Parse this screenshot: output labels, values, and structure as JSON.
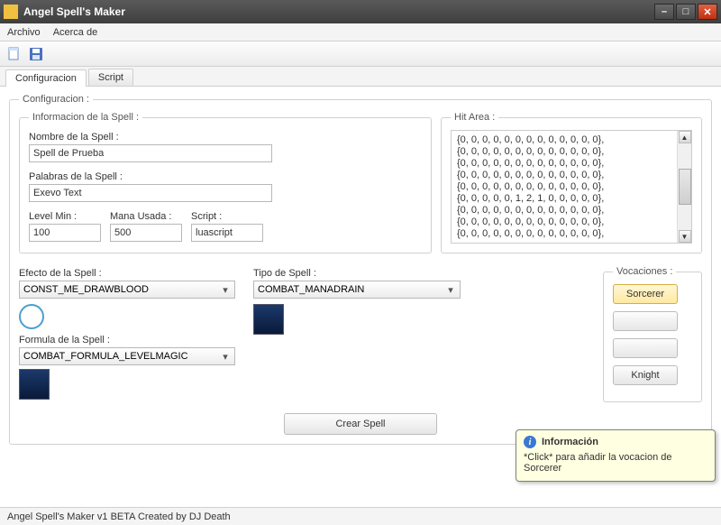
{
  "titlebar": {
    "title": "Angel Spell's Maker"
  },
  "menu": {
    "file": "Archivo",
    "about": "Acerca de"
  },
  "tabs": {
    "config": "Configuracion",
    "script": "Script"
  },
  "groups": {
    "config": "Configuracion :",
    "info": "Informacion de la Spell :",
    "hitarea": "Hit Area :",
    "vocaciones": "Vocaciones :"
  },
  "labels": {
    "name": "Nombre de la Spell :",
    "words": "Palabras de la Spell :",
    "level": "Level Min :",
    "mana": "Mana Usada :",
    "script": "Script :",
    "effect": "Efecto de la Spell :",
    "type": "Tipo de Spell :",
    "formula": "Formula de la Spell :"
  },
  "values": {
    "name": "Spell de Prueba",
    "words": "Exevo Text",
    "level": "100",
    "mana": "500",
    "script": "luascript",
    "effect": "CONST_ME_DRAWBLOOD",
    "type": "COMBAT_MANADRAIN",
    "formula": "COMBAT_FORMULA_LEVELMAGIC"
  },
  "hitarea_lines": [
    "{0, 0, 0, 0, 0, 0, 0, 0, 0, 0, 0, 0, 0},",
    "{0, 0, 0, 0, 0, 0, 0, 0, 0, 0, 0, 0, 0},",
    "{0, 0, 0, 0, 0, 0, 0, 0, 0, 0, 0, 0, 0},",
    "{0, 0, 0, 0, 0, 0, 0, 0, 0, 0, 0, 0, 0},",
    "{0, 0, 0, 0, 0, 0, 0, 0, 0, 0, 0, 0, 0},",
    "{0, 0, 0, 0, 0, 1, 2, 1, 0, 0, 0, 0, 0},",
    "{0, 0, 0, 0, 0, 0, 0, 0, 0, 0, 0, 0, 0},",
    "{0, 0, 0, 0, 0, 0, 0, 0, 0, 0, 0, 0, 0},",
    "{0, 0, 0, 0, 0, 0, 0, 0, 0, 0, 0, 0, 0},"
  ],
  "vocations": {
    "sorcerer": "Sorcerer",
    "knight": "Knight"
  },
  "tooltip": {
    "title": "Información",
    "body": "*Click* para añadir la vocacion de Sorcerer"
  },
  "create": "Crear Spell",
  "status": "Angel Spell's Maker v1 BETA Created by DJ Death"
}
